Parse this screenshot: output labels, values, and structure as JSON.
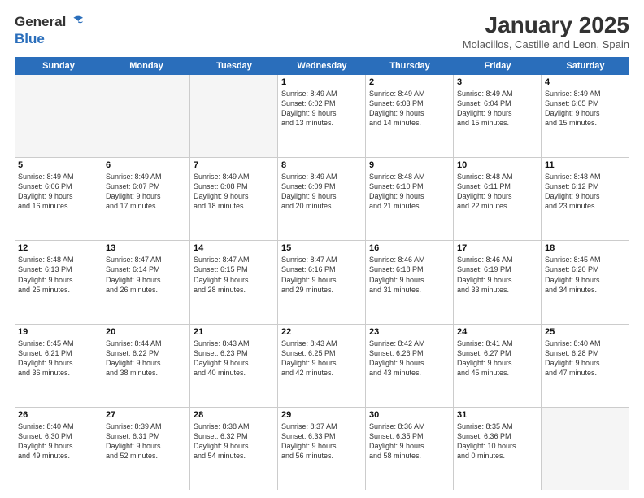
{
  "header": {
    "logo_general": "General",
    "logo_blue": "Blue",
    "month_title": "January 2025",
    "subtitle": "Molacillos, Castille and Leon, Spain"
  },
  "weekdays": [
    "Sunday",
    "Monday",
    "Tuesday",
    "Wednesday",
    "Thursday",
    "Friday",
    "Saturday"
  ],
  "rows": [
    [
      {
        "day": "",
        "empty": true,
        "lines": []
      },
      {
        "day": "",
        "empty": true,
        "lines": []
      },
      {
        "day": "",
        "empty": true,
        "lines": []
      },
      {
        "day": "1",
        "empty": false,
        "lines": [
          "Sunrise: 8:49 AM",
          "Sunset: 6:02 PM",
          "Daylight: 9 hours",
          "and 13 minutes."
        ]
      },
      {
        "day": "2",
        "empty": false,
        "lines": [
          "Sunrise: 8:49 AM",
          "Sunset: 6:03 PM",
          "Daylight: 9 hours",
          "and 14 minutes."
        ]
      },
      {
        "day": "3",
        "empty": false,
        "lines": [
          "Sunrise: 8:49 AM",
          "Sunset: 6:04 PM",
          "Daylight: 9 hours",
          "and 15 minutes."
        ]
      },
      {
        "day": "4",
        "empty": false,
        "lines": [
          "Sunrise: 8:49 AM",
          "Sunset: 6:05 PM",
          "Daylight: 9 hours",
          "and 15 minutes."
        ]
      }
    ],
    [
      {
        "day": "5",
        "empty": false,
        "lines": [
          "Sunrise: 8:49 AM",
          "Sunset: 6:06 PM",
          "Daylight: 9 hours",
          "and 16 minutes."
        ]
      },
      {
        "day": "6",
        "empty": false,
        "lines": [
          "Sunrise: 8:49 AM",
          "Sunset: 6:07 PM",
          "Daylight: 9 hours",
          "and 17 minutes."
        ]
      },
      {
        "day": "7",
        "empty": false,
        "lines": [
          "Sunrise: 8:49 AM",
          "Sunset: 6:08 PM",
          "Daylight: 9 hours",
          "and 18 minutes."
        ]
      },
      {
        "day": "8",
        "empty": false,
        "lines": [
          "Sunrise: 8:49 AM",
          "Sunset: 6:09 PM",
          "Daylight: 9 hours",
          "and 20 minutes."
        ]
      },
      {
        "day": "9",
        "empty": false,
        "lines": [
          "Sunrise: 8:48 AM",
          "Sunset: 6:10 PM",
          "Daylight: 9 hours",
          "and 21 minutes."
        ]
      },
      {
        "day": "10",
        "empty": false,
        "lines": [
          "Sunrise: 8:48 AM",
          "Sunset: 6:11 PM",
          "Daylight: 9 hours",
          "and 22 minutes."
        ]
      },
      {
        "day": "11",
        "empty": false,
        "lines": [
          "Sunrise: 8:48 AM",
          "Sunset: 6:12 PM",
          "Daylight: 9 hours",
          "and 23 minutes."
        ]
      }
    ],
    [
      {
        "day": "12",
        "empty": false,
        "lines": [
          "Sunrise: 8:48 AM",
          "Sunset: 6:13 PM",
          "Daylight: 9 hours",
          "and 25 minutes."
        ]
      },
      {
        "day": "13",
        "empty": false,
        "lines": [
          "Sunrise: 8:47 AM",
          "Sunset: 6:14 PM",
          "Daylight: 9 hours",
          "and 26 minutes."
        ]
      },
      {
        "day": "14",
        "empty": false,
        "lines": [
          "Sunrise: 8:47 AM",
          "Sunset: 6:15 PM",
          "Daylight: 9 hours",
          "and 28 minutes."
        ]
      },
      {
        "day": "15",
        "empty": false,
        "lines": [
          "Sunrise: 8:47 AM",
          "Sunset: 6:16 PM",
          "Daylight: 9 hours",
          "and 29 minutes."
        ]
      },
      {
        "day": "16",
        "empty": false,
        "lines": [
          "Sunrise: 8:46 AM",
          "Sunset: 6:18 PM",
          "Daylight: 9 hours",
          "and 31 minutes."
        ]
      },
      {
        "day": "17",
        "empty": false,
        "lines": [
          "Sunrise: 8:46 AM",
          "Sunset: 6:19 PM",
          "Daylight: 9 hours",
          "and 33 minutes."
        ]
      },
      {
        "day": "18",
        "empty": false,
        "lines": [
          "Sunrise: 8:45 AM",
          "Sunset: 6:20 PM",
          "Daylight: 9 hours",
          "and 34 minutes."
        ]
      }
    ],
    [
      {
        "day": "19",
        "empty": false,
        "lines": [
          "Sunrise: 8:45 AM",
          "Sunset: 6:21 PM",
          "Daylight: 9 hours",
          "and 36 minutes."
        ]
      },
      {
        "day": "20",
        "empty": false,
        "lines": [
          "Sunrise: 8:44 AM",
          "Sunset: 6:22 PM",
          "Daylight: 9 hours",
          "and 38 minutes."
        ]
      },
      {
        "day": "21",
        "empty": false,
        "lines": [
          "Sunrise: 8:43 AM",
          "Sunset: 6:23 PM",
          "Daylight: 9 hours",
          "and 40 minutes."
        ]
      },
      {
        "day": "22",
        "empty": false,
        "lines": [
          "Sunrise: 8:43 AM",
          "Sunset: 6:25 PM",
          "Daylight: 9 hours",
          "and 42 minutes."
        ]
      },
      {
        "day": "23",
        "empty": false,
        "lines": [
          "Sunrise: 8:42 AM",
          "Sunset: 6:26 PM",
          "Daylight: 9 hours",
          "and 43 minutes."
        ]
      },
      {
        "day": "24",
        "empty": false,
        "lines": [
          "Sunrise: 8:41 AM",
          "Sunset: 6:27 PM",
          "Daylight: 9 hours",
          "and 45 minutes."
        ]
      },
      {
        "day": "25",
        "empty": false,
        "lines": [
          "Sunrise: 8:40 AM",
          "Sunset: 6:28 PM",
          "Daylight: 9 hours",
          "and 47 minutes."
        ]
      }
    ],
    [
      {
        "day": "26",
        "empty": false,
        "lines": [
          "Sunrise: 8:40 AM",
          "Sunset: 6:30 PM",
          "Daylight: 9 hours",
          "and 49 minutes."
        ]
      },
      {
        "day": "27",
        "empty": false,
        "lines": [
          "Sunrise: 8:39 AM",
          "Sunset: 6:31 PM",
          "Daylight: 9 hours",
          "and 52 minutes."
        ]
      },
      {
        "day": "28",
        "empty": false,
        "lines": [
          "Sunrise: 8:38 AM",
          "Sunset: 6:32 PM",
          "Daylight: 9 hours",
          "and 54 minutes."
        ]
      },
      {
        "day": "29",
        "empty": false,
        "lines": [
          "Sunrise: 8:37 AM",
          "Sunset: 6:33 PM",
          "Daylight: 9 hours",
          "and 56 minutes."
        ]
      },
      {
        "day": "30",
        "empty": false,
        "lines": [
          "Sunrise: 8:36 AM",
          "Sunset: 6:35 PM",
          "Daylight: 9 hours",
          "and 58 minutes."
        ]
      },
      {
        "day": "31",
        "empty": false,
        "lines": [
          "Sunrise: 8:35 AM",
          "Sunset: 6:36 PM",
          "Daylight: 10 hours",
          "and 0 minutes."
        ]
      },
      {
        "day": "",
        "empty": true,
        "lines": []
      }
    ]
  ]
}
